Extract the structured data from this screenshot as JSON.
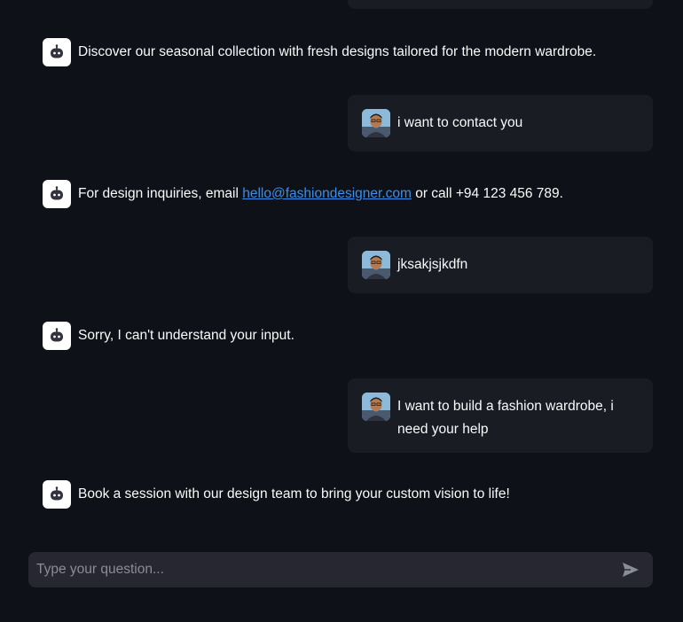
{
  "messages": [
    {
      "role": "assistant",
      "avatar": "robot-icon",
      "text": "Discover our seasonal collection with fresh designs tailored for the modern wardrobe."
    },
    {
      "role": "user",
      "avatar": "user-photo",
      "text": "i want to contact you"
    },
    {
      "role": "assistant",
      "avatar": "robot-icon",
      "text_before": "For design inquiries, email ",
      "link": "hello@fashiondesigner.com",
      "text_after": " or call +94 123 456 789."
    },
    {
      "role": "user",
      "avatar": "user-photo",
      "text": "jksakjsjkdfn"
    },
    {
      "role": "assistant",
      "avatar": "robot-icon",
      "text": "Sorry, I can't understand your input."
    },
    {
      "role": "user",
      "avatar": "user-photo",
      "text": "I want to build a fashion wardrobe, i need your help"
    },
    {
      "role": "assistant",
      "avatar": "robot-icon",
      "text": "Book a session with our design team to bring your custom vision to life!"
    }
  ],
  "chat_input": {
    "placeholder": "Type your question...",
    "value": "",
    "send_icon": "send-icon"
  },
  "colors": {
    "background": "#0e1117",
    "user_bubble": "#1a1c24",
    "input_background": "#262730",
    "link": "#3b8eea",
    "text": "#fafafa"
  }
}
